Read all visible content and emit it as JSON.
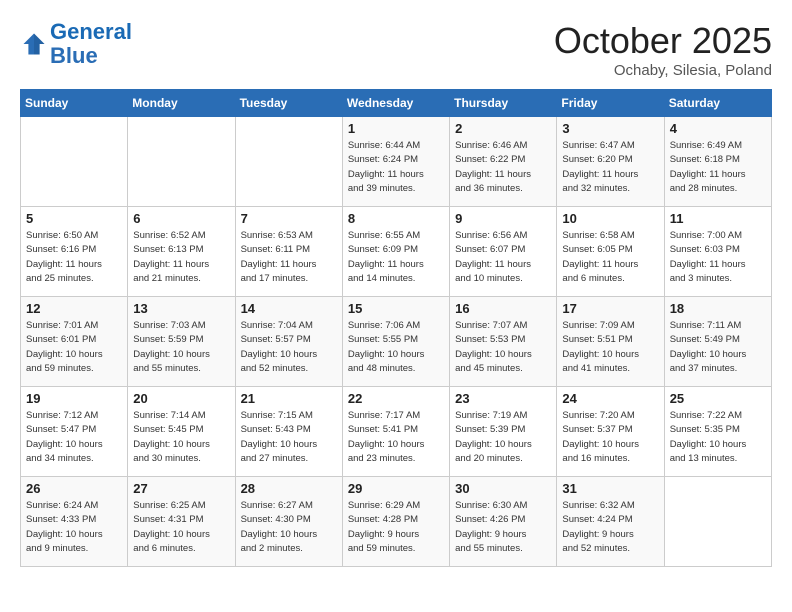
{
  "header": {
    "logo_line1": "General",
    "logo_line2": "Blue",
    "month_title": "October 2025",
    "location": "Ochaby, Silesia, Poland"
  },
  "days_of_week": [
    "Sunday",
    "Monday",
    "Tuesday",
    "Wednesday",
    "Thursday",
    "Friday",
    "Saturday"
  ],
  "weeks": [
    [
      {
        "day": "",
        "info": ""
      },
      {
        "day": "",
        "info": ""
      },
      {
        "day": "",
        "info": ""
      },
      {
        "day": "1",
        "info": "Sunrise: 6:44 AM\nSunset: 6:24 PM\nDaylight: 11 hours\nand 39 minutes."
      },
      {
        "day": "2",
        "info": "Sunrise: 6:46 AM\nSunset: 6:22 PM\nDaylight: 11 hours\nand 36 minutes."
      },
      {
        "day": "3",
        "info": "Sunrise: 6:47 AM\nSunset: 6:20 PM\nDaylight: 11 hours\nand 32 minutes."
      },
      {
        "day": "4",
        "info": "Sunrise: 6:49 AM\nSunset: 6:18 PM\nDaylight: 11 hours\nand 28 minutes."
      }
    ],
    [
      {
        "day": "5",
        "info": "Sunrise: 6:50 AM\nSunset: 6:16 PM\nDaylight: 11 hours\nand 25 minutes."
      },
      {
        "day": "6",
        "info": "Sunrise: 6:52 AM\nSunset: 6:13 PM\nDaylight: 11 hours\nand 21 minutes."
      },
      {
        "day": "7",
        "info": "Sunrise: 6:53 AM\nSunset: 6:11 PM\nDaylight: 11 hours\nand 17 minutes."
      },
      {
        "day": "8",
        "info": "Sunrise: 6:55 AM\nSunset: 6:09 PM\nDaylight: 11 hours\nand 14 minutes."
      },
      {
        "day": "9",
        "info": "Sunrise: 6:56 AM\nSunset: 6:07 PM\nDaylight: 11 hours\nand 10 minutes."
      },
      {
        "day": "10",
        "info": "Sunrise: 6:58 AM\nSunset: 6:05 PM\nDaylight: 11 hours\nand 6 minutes."
      },
      {
        "day": "11",
        "info": "Sunrise: 7:00 AM\nSunset: 6:03 PM\nDaylight: 11 hours\nand 3 minutes."
      }
    ],
    [
      {
        "day": "12",
        "info": "Sunrise: 7:01 AM\nSunset: 6:01 PM\nDaylight: 10 hours\nand 59 minutes."
      },
      {
        "day": "13",
        "info": "Sunrise: 7:03 AM\nSunset: 5:59 PM\nDaylight: 10 hours\nand 55 minutes."
      },
      {
        "day": "14",
        "info": "Sunrise: 7:04 AM\nSunset: 5:57 PM\nDaylight: 10 hours\nand 52 minutes."
      },
      {
        "day": "15",
        "info": "Sunrise: 7:06 AM\nSunset: 5:55 PM\nDaylight: 10 hours\nand 48 minutes."
      },
      {
        "day": "16",
        "info": "Sunrise: 7:07 AM\nSunset: 5:53 PM\nDaylight: 10 hours\nand 45 minutes."
      },
      {
        "day": "17",
        "info": "Sunrise: 7:09 AM\nSunset: 5:51 PM\nDaylight: 10 hours\nand 41 minutes."
      },
      {
        "day": "18",
        "info": "Sunrise: 7:11 AM\nSunset: 5:49 PM\nDaylight: 10 hours\nand 37 minutes."
      }
    ],
    [
      {
        "day": "19",
        "info": "Sunrise: 7:12 AM\nSunset: 5:47 PM\nDaylight: 10 hours\nand 34 minutes."
      },
      {
        "day": "20",
        "info": "Sunrise: 7:14 AM\nSunset: 5:45 PM\nDaylight: 10 hours\nand 30 minutes."
      },
      {
        "day": "21",
        "info": "Sunrise: 7:15 AM\nSunset: 5:43 PM\nDaylight: 10 hours\nand 27 minutes."
      },
      {
        "day": "22",
        "info": "Sunrise: 7:17 AM\nSunset: 5:41 PM\nDaylight: 10 hours\nand 23 minutes."
      },
      {
        "day": "23",
        "info": "Sunrise: 7:19 AM\nSunset: 5:39 PM\nDaylight: 10 hours\nand 20 minutes."
      },
      {
        "day": "24",
        "info": "Sunrise: 7:20 AM\nSunset: 5:37 PM\nDaylight: 10 hours\nand 16 minutes."
      },
      {
        "day": "25",
        "info": "Sunrise: 7:22 AM\nSunset: 5:35 PM\nDaylight: 10 hours\nand 13 minutes."
      }
    ],
    [
      {
        "day": "26",
        "info": "Sunrise: 6:24 AM\nSunset: 4:33 PM\nDaylight: 10 hours\nand 9 minutes."
      },
      {
        "day": "27",
        "info": "Sunrise: 6:25 AM\nSunset: 4:31 PM\nDaylight: 10 hours\nand 6 minutes."
      },
      {
        "day": "28",
        "info": "Sunrise: 6:27 AM\nSunset: 4:30 PM\nDaylight: 10 hours\nand 2 minutes."
      },
      {
        "day": "29",
        "info": "Sunrise: 6:29 AM\nSunset: 4:28 PM\nDaylight: 9 hours\nand 59 minutes."
      },
      {
        "day": "30",
        "info": "Sunrise: 6:30 AM\nSunset: 4:26 PM\nDaylight: 9 hours\nand 55 minutes."
      },
      {
        "day": "31",
        "info": "Sunrise: 6:32 AM\nSunset: 4:24 PM\nDaylight: 9 hours\nand 52 minutes."
      },
      {
        "day": "",
        "info": ""
      }
    ]
  ]
}
